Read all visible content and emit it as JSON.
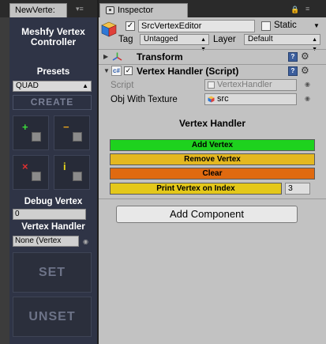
{
  "left_panel": {
    "tab_label": "NewVerte:",
    "title_line1": "Meshfy Vertex",
    "title_line2": "Controller",
    "presets_label": "Presets",
    "preset_value": "QUAD",
    "create_label": "CREATE",
    "tool_buttons": [
      {
        "symbol": "+",
        "color": "#3adb3a"
      },
      {
        "symbol": "−",
        "color": "#e0a020"
      },
      {
        "symbol": "×",
        "color": "#e03030"
      },
      {
        "symbol": "i",
        "color": "#e8d81c"
      }
    ],
    "debug_vertex_label": "Debug Vertex",
    "debug_vertex_value": "0",
    "vertex_handler_label": "Vertex Handler",
    "vertex_handler_value": "None (Vertex",
    "set_label": "SET",
    "unset_label": "UNSET"
  },
  "inspector": {
    "tab_label": "Inspector",
    "object_name": "SrcVertexEditor",
    "active": true,
    "static_label": "Static",
    "static_checked": false,
    "tag_label": "Tag",
    "tag_value": "Untagged",
    "layer_label": "Layer",
    "layer_value": "Default",
    "transform_title": "Transform",
    "script_component_title": "Vertex Handler (Script)",
    "script_label": "Script",
    "script_value": "VertexHandler",
    "obj_texture_label": "Obj With Texture",
    "obj_texture_value": "src",
    "section_title": "Vertex Handler",
    "buttons": [
      {
        "label": "Add Vertex",
        "color": "#1ed21e"
      },
      {
        "label": "Remove Vertex",
        "color": "#e4b820"
      },
      {
        "label": "Clear",
        "color": "#e06a10"
      },
      {
        "label": "Print Vertex on Index",
        "color": "#e4c81a"
      }
    ],
    "print_index_value": "3",
    "add_component_label": "Add Component"
  }
}
